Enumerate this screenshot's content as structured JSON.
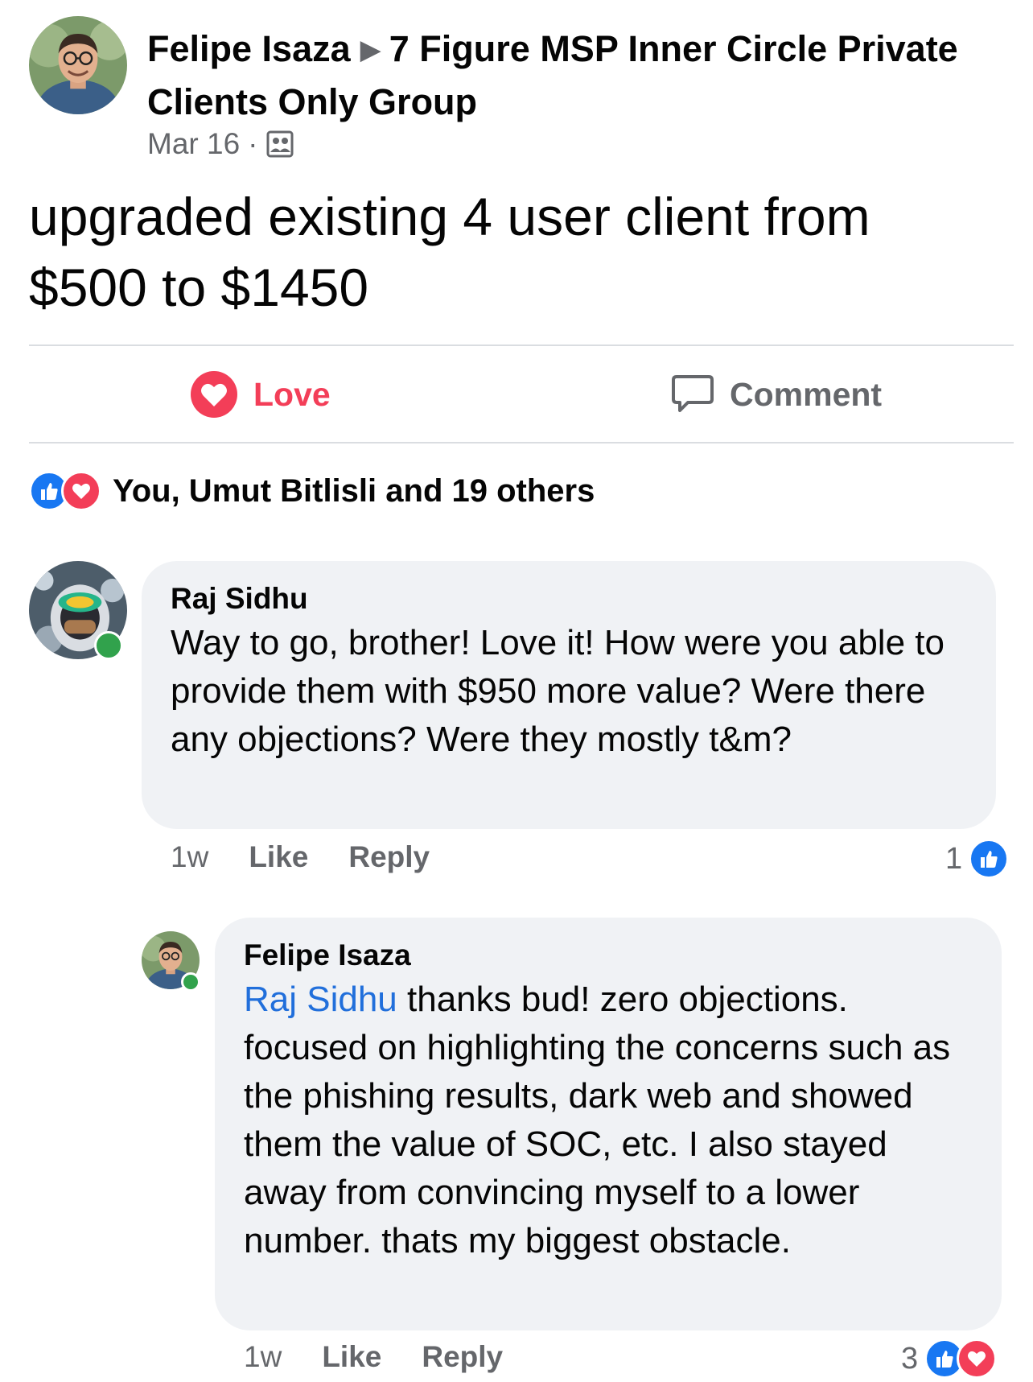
{
  "post": {
    "author": "Felipe Isaza",
    "group": "7 Figure MSP Inner Circle Private Clients Only Group",
    "date": "Mar 16",
    "separator": "·",
    "privacy_icon": "group-icon",
    "text_line1": "upgraded existing 4 user client from",
    "text_line2": "$500 to $1450"
  },
  "actions": {
    "love_label": "Love",
    "comment_label": "Comment"
  },
  "reactions": {
    "summary": "You, Umut Bitlisli and 19 others",
    "icons": [
      "like-icon",
      "love-icon"
    ]
  },
  "comments": [
    {
      "author": "Raj Sidhu",
      "text": "Way to go, brother! Love it! How were you able to provide them with $950 more value? Were there any objections? Were they mostly t&m?",
      "time": "1w",
      "like_label": "Like",
      "reply_label": "Reply",
      "reaction_count": "1",
      "online": true
    },
    {
      "author": "Felipe Isaza",
      "mention": "Raj Sidhu",
      "text": " thanks bud! zero objections. focused on highlighting the concerns such as the phishing results, dark web and showed them the value of SOC, etc. I also stayed away from convincing myself to a lower number. thats my biggest obstacle.",
      "time": "1w",
      "like_label": "Like",
      "reply_label": "Reply",
      "reaction_count": "3",
      "online": true
    }
  ],
  "colors": {
    "love": "#f33e58",
    "like": "#1877f2",
    "mention": "#216fdb",
    "online": "#31a24c",
    "bubble": "#f0f2f5"
  }
}
